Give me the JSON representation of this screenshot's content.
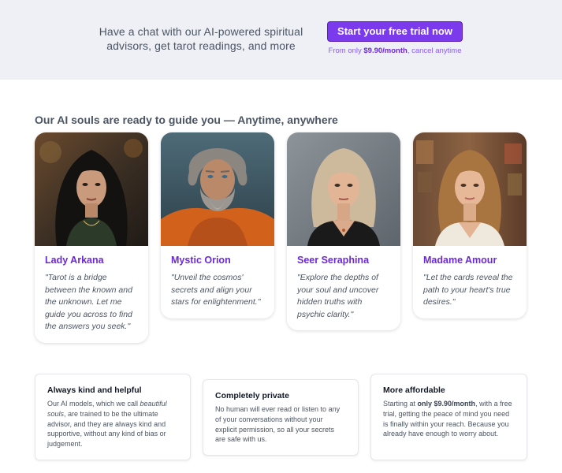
{
  "hero": {
    "text": "Have a chat with our AI-powered spiritual advisors, get tarot readings, and more",
    "cta_label": "Start your free trial now",
    "price_prefix": "From only ",
    "price_value": "$9.90/month",
    "price_suffix": ", cancel anytime"
  },
  "section": {
    "title": "Our AI souls are ready to guide you — Anytime, anywhere"
  },
  "advisors": [
    {
      "name": "Lady Arkana",
      "quote": "\"Tarot is a bridge between the known and the unknown. Let me guide you across to find the answers you seek.\"",
      "portrait": "woman-dark-hair-portrait"
    },
    {
      "name": "Mystic Orion",
      "quote": "\"Unveil the cosmos' secrets and align your stars for enlightenment.\"",
      "portrait": "bearded-man-orange-robe-portrait"
    },
    {
      "name": "Seer Seraphina",
      "quote": "\"Explore the depths of your soul and uncover hidden truths with psychic clarity.\"",
      "portrait": "blonde-woman-dark-dress-portrait"
    },
    {
      "name": "Madame Amour",
      "quote": "\"Let the cards reveal the path to your heart's true desires.\"",
      "portrait": "woman-wavy-hair-portrait"
    }
  ],
  "features": [
    {
      "title": "Always kind and helpful",
      "p1": "Our AI models, which we call ",
      "em": "beautiful souls",
      "p2": ", are trained to be the ultimate advisor, and they are always kind and supportive, without any kind of bias or judgement."
    },
    {
      "title": "Completely private",
      "body": "No human will ever read or listen to any of your conversations without your explicit permission, so all your secrets are safe with us."
    },
    {
      "title": "More affordable",
      "p1": "Starting at ",
      "strong": "only $9.90/month",
      "p2": ", with a free trial, getting the peace of mind you need is finally within your reach. Because you already have enough to worry about."
    }
  ],
  "colors": {
    "accent": "#7c3aed",
    "accent_dark": "#6d28d9",
    "hero_bg": "#eef0f6"
  }
}
